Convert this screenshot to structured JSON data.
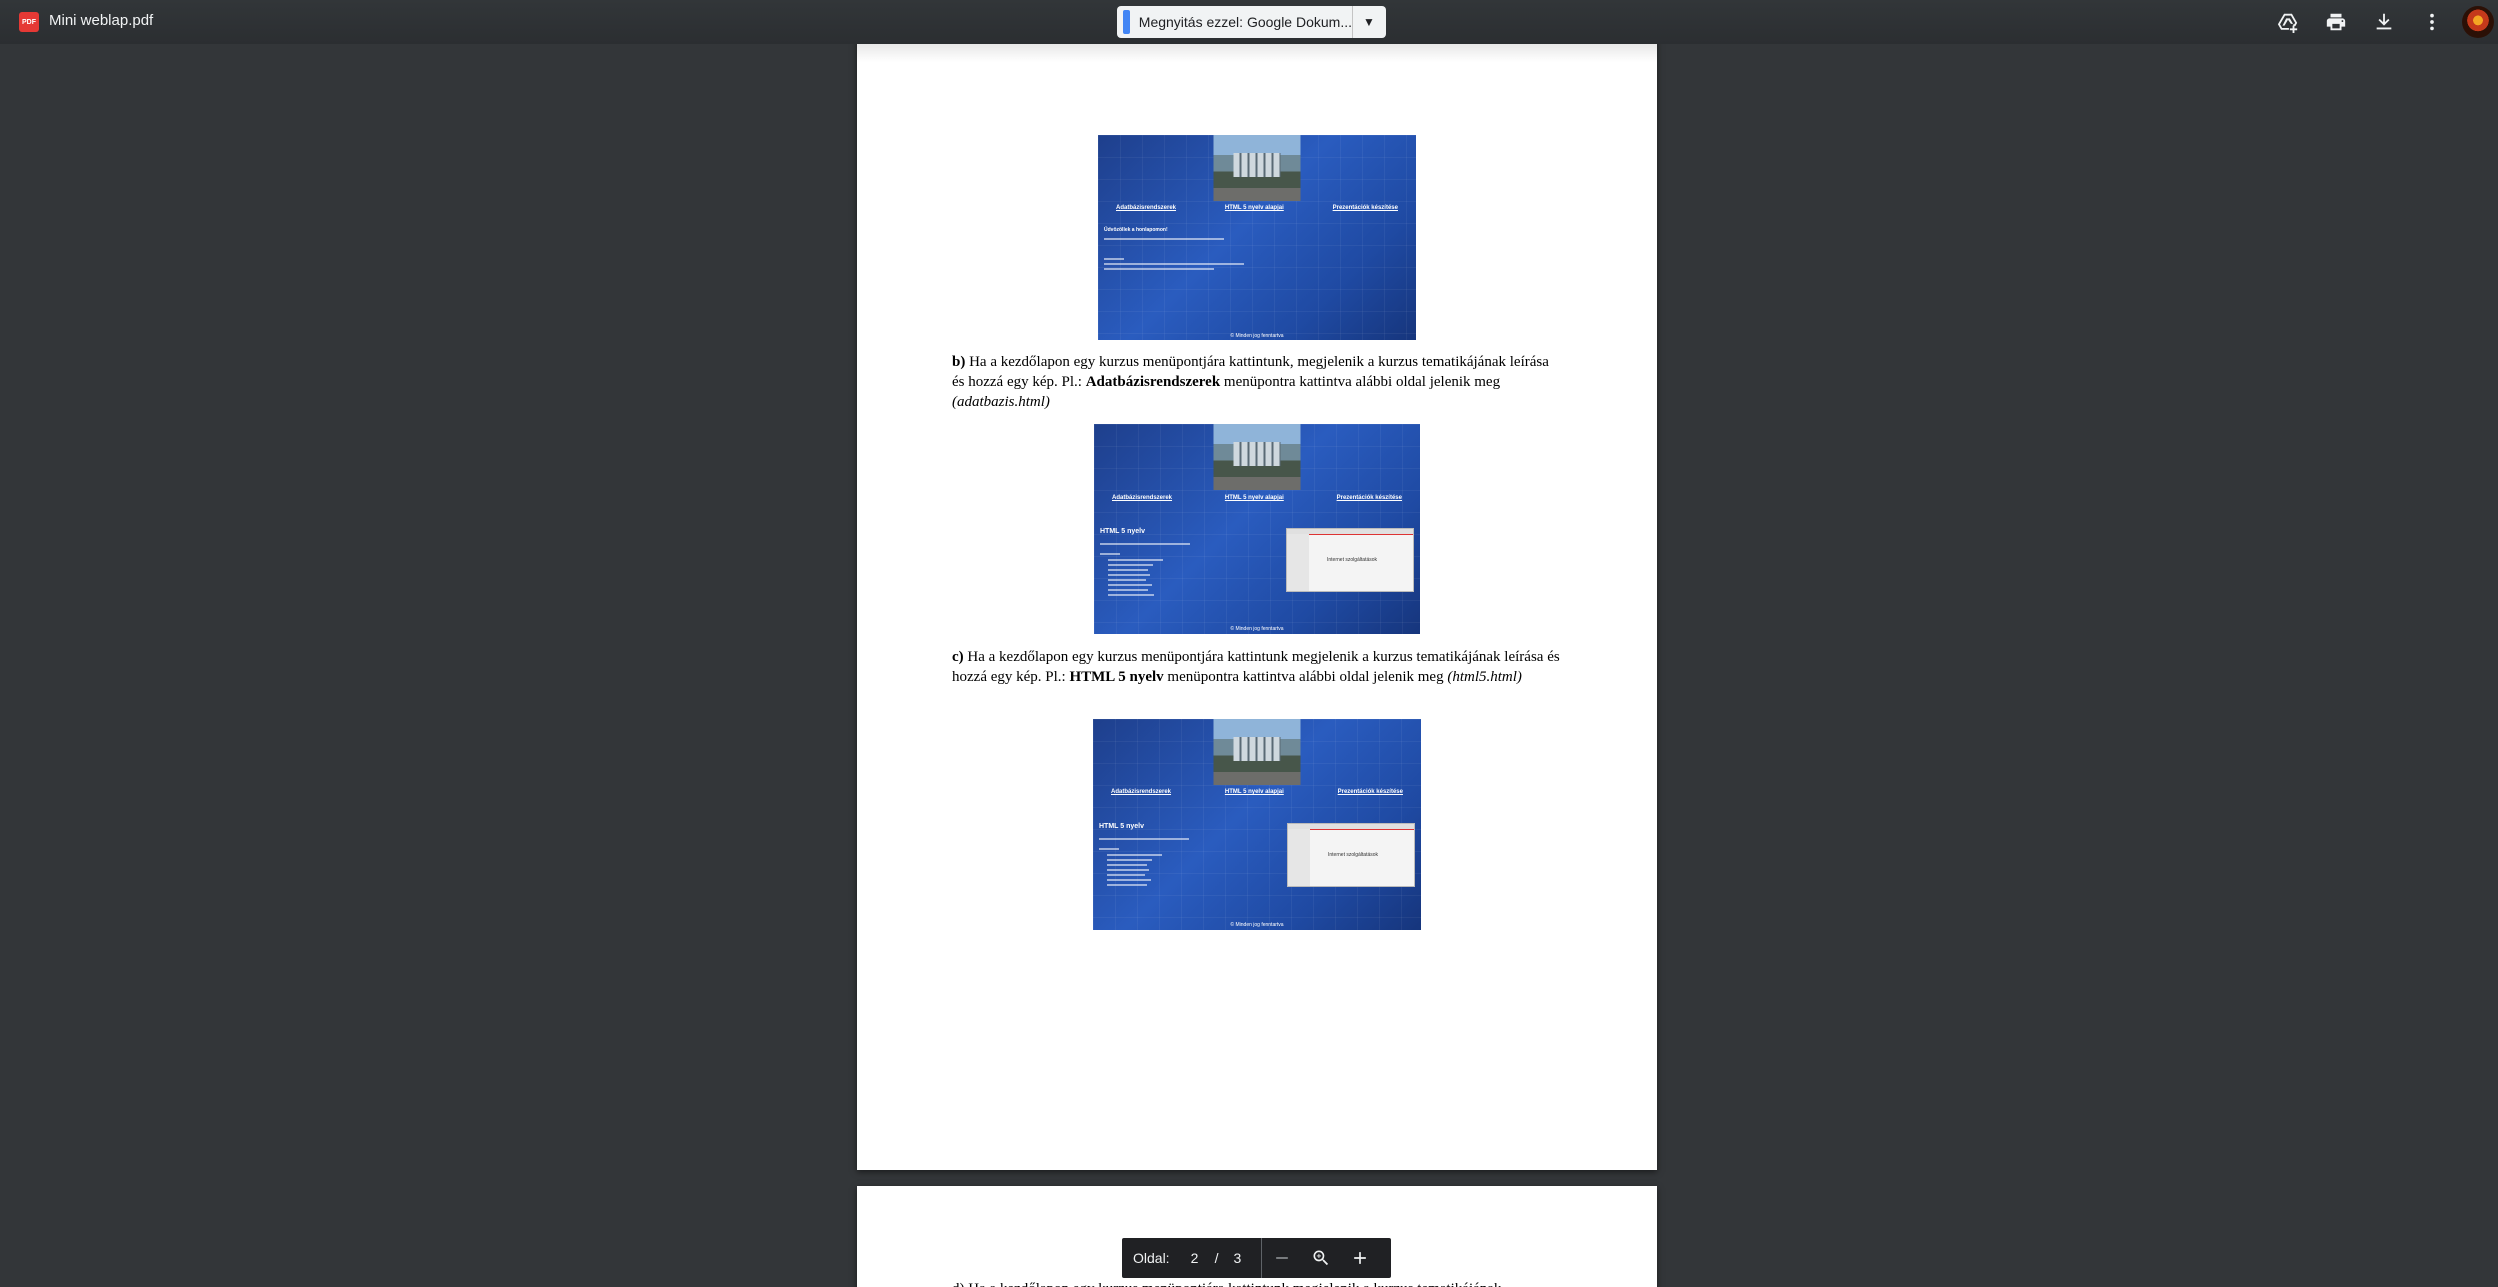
{
  "toolbar": {
    "file_badge": "PDF",
    "file_title": "Mini weblap.pdf",
    "open_with_label": "Megnyitás ezzel: Google Dokum...",
    "icons": [
      "add-to-drive-icon",
      "print-icon",
      "download-icon",
      "more-vert-icon"
    ]
  },
  "document": {
    "para_b": {
      "prefix": "b)",
      "text1": " Ha a kezdőlapon egy kurzus menüpontjára kattintunk, megjelenik a kurzus tematikájának leírása és hozzá egy kép. Pl.: ",
      "bold": "Adatbázisrendszerek",
      "text2": " menüpontra kattintva alábbi oldal jelenik meg ",
      "italic": "(adatbazis.html)"
    },
    "para_c": {
      "prefix": "c)",
      "text1": " Ha a kezdőlapon egy kurzus menüpontjára kattintunk megjelenik a kurzus tematikájának leírása és hozzá egy kép. Pl.: ",
      "bold": "HTML 5 nyelv",
      "text2": " menüpontra kattintva alábbi oldal jelenik meg ",
      "italic": "(html5.html)"
    },
    "next_page_partial": "d) Ha a kezdőlapon egy kurzus menüpontjára kattintunk megjelenik a kurzus tematikájának"
  },
  "screenshots": {
    "nav": [
      "Adatbázisrendszerek",
      "HTML 5 nyelv alapjai",
      "Prezentációk készítése"
    ],
    "home_heading": "Üdvözöllek a honlapomon!",
    "html5_heading": "HTML 5 nyelv",
    "footer": "© Minden jog fenntartva",
    "window_text": "Internet szolgáltatások"
  },
  "zoombar": {
    "label": "Oldal:",
    "current_page": "2",
    "separator": "/",
    "total_pages": "3"
  }
}
